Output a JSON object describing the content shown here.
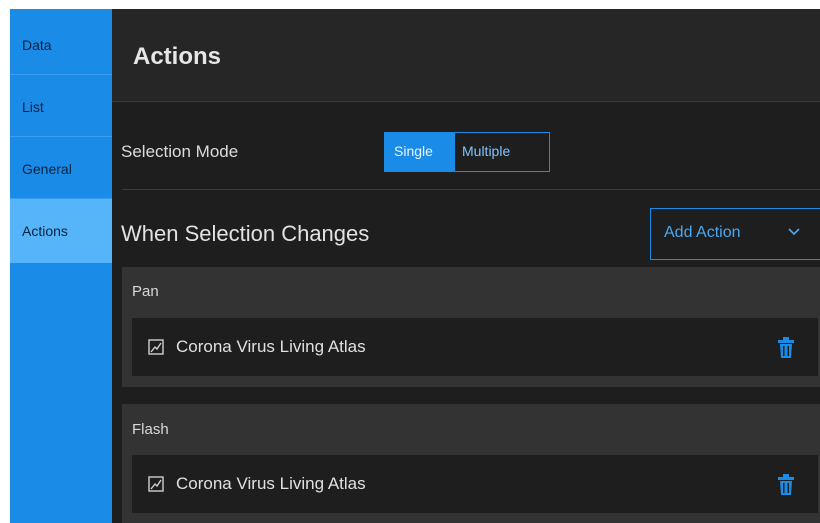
{
  "sidebar": {
    "tabs": [
      {
        "label": "Data"
      },
      {
        "label": "List"
      },
      {
        "label": "General"
      },
      {
        "label": "Actions"
      }
    ],
    "active_index": 3
  },
  "header": {
    "title": "Actions"
  },
  "selection_mode": {
    "label": "Selection Mode",
    "options": [
      "Single",
      "Multiple"
    ],
    "selected": "Single"
  },
  "when_selection": {
    "label": "When Selection Changes",
    "add_action_label": "Add Action"
  },
  "actions": [
    {
      "title": "Pan",
      "layer": "Corona Virus Living Atlas"
    },
    {
      "title": "Flash",
      "layer": "Corona Virus Living Atlas"
    }
  ],
  "icons": {
    "layer": "layer-edit-icon",
    "delete": "trash-icon",
    "dropdown": "chevron-down-icon"
  },
  "colors": {
    "accent": "#1a8ce8",
    "sidebar_active": "#56b4f8",
    "panel_bg": "#1e1e1e",
    "card_bg": "#333333"
  }
}
